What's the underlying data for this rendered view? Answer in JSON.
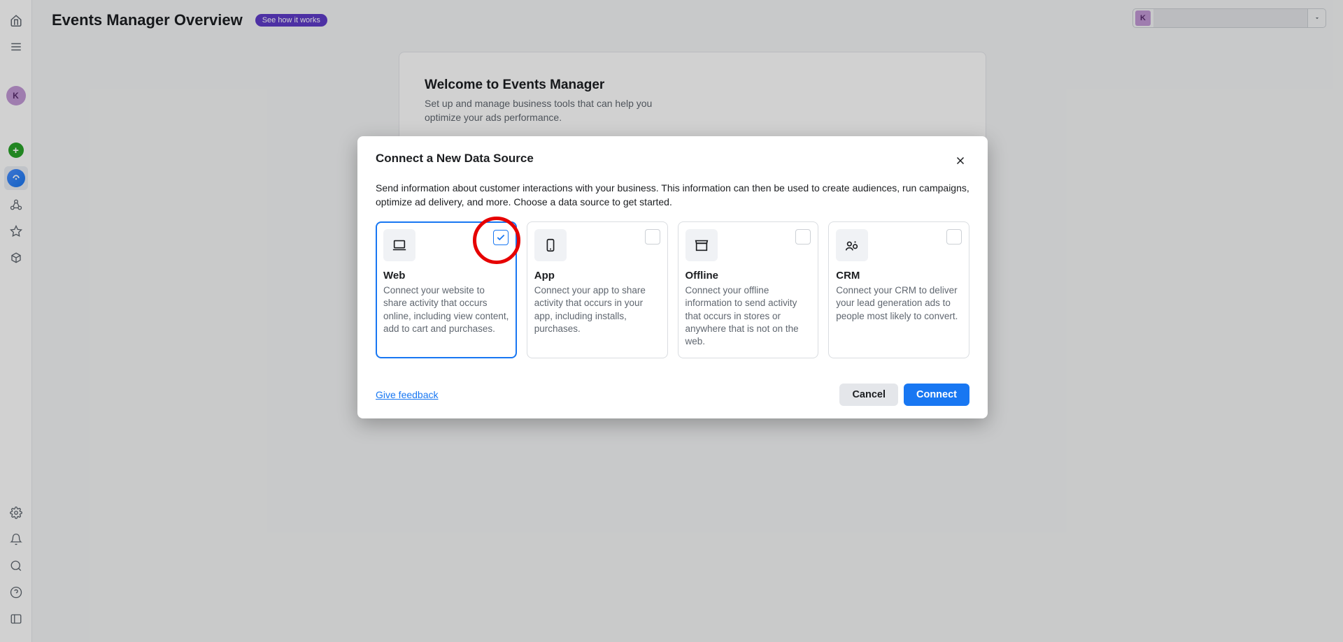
{
  "header": {
    "pageTitle": "Events Manager Overview",
    "seeHowLabel": "See how it works",
    "accountAvatarLetter": "K"
  },
  "sidebar": {
    "avatarLetter": "K"
  },
  "welcome": {
    "title": "Welcome to Events Manager",
    "subtitle": "Set up and manage business tools that can help you optimize your ads performance."
  },
  "modal": {
    "title": "Connect a New Data Source",
    "subtitle": "Send information about customer interactions with your business. This information can then be used to create audiences, run campaigns, optimize ad delivery, and more. Choose a data source to get started.",
    "options": [
      {
        "title": "Web",
        "desc": "Connect your website to share activity that occurs online, including view content, add to cart and purchases."
      },
      {
        "title": "App",
        "desc": "Connect your app to share activity that occurs in your app, including installs, purchases."
      },
      {
        "title": "Offline",
        "desc": "Connect your offline information to send activity that occurs in stores or anywhere that is not on the web."
      },
      {
        "title": "CRM",
        "desc": "Connect your CRM to deliver your lead generation ads to people most likely to convert."
      }
    ],
    "giveFeedback": "Give feedback",
    "cancelLabel": "Cancel",
    "connectLabel": "Connect"
  }
}
